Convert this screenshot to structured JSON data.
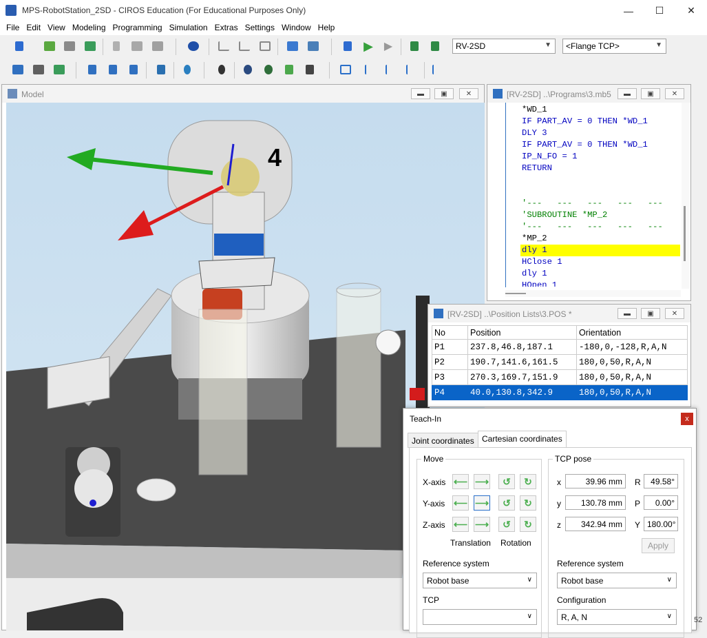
{
  "window": {
    "title": "MPS-RobotStation_2SD - CIROS Education (For Educational Purposes Only)",
    "minimize": "—",
    "maximize": "☐",
    "close": "✕"
  },
  "menu": [
    "File",
    "Edit",
    "View",
    "Modeling",
    "Programming",
    "Simulation",
    "Extras",
    "Settings",
    "Window",
    "Help"
  ],
  "toolbar": {
    "robot_select": "RV-2SD",
    "tcp_select": "<Flange TCP>"
  },
  "model_window": {
    "title": "Model",
    "axis_label": "4"
  },
  "program_window": {
    "title": "[RV-2SD] ..\\Programs\\3.mb5",
    "lines": [
      {
        "text": "*WD_1",
        "color": "#000000",
        "highlight": false
      },
      {
        "text": "IF PART_AV = 0 THEN *WD_1",
        "color": "#0000c0",
        "highlight": false
      },
      {
        "text": "DLY 3",
        "color": "#0000c0",
        "highlight": false
      },
      {
        "text": "IF PART_AV = 0 THEN *WD_1",
        "color": "#0000c0",
        "highlight": false
      },
      {
        "text": "IP_N_FO = 1",
        "color": "#0000c0",
        "highlight": false
      },
      {
        "text": "RETURN",
        "color": "#0000c0",
        "highlight": false
      },
      {
        "text": "",
        "color": "#000000",
        "highlight": false
      },
      {
        "text": "",
        "color": "#000000",
        "highlight": false
      },
      {
        "text": "'---   ---   ---   ---   ---",
        "color": "#008000",
        "highlight": false
      },
      {
        "text": "'SUBROUTINE *MP_2",
        "color": "#008000",
        "highlight": false
      },
      {
        "text": "'---   ---   ---   ---   ---",
        "color": "#008000",
        "highlight": false
      },
      {
        "text": "*MP_2",
        "color": "#000000",
        "highlight": false
      },
      {
        "text": "dly 1",
        "color": "#0000c0",
        "highlight": true
      },
      {
        "text": "HClose 1",
        "color": "#0000c0",
        "highlight": false
      },
      {
        "text": "dly 1",
        "color": "#0000c0",
        "highlight": false
      },
      {
        "text": "HOpen 1",
        "color": "#0000c0",
        "highlight": false
      }
    ]
  },
  "positions_window": {
    "title": "[RV-2SD] ..\\Position Lists\\3.POS *",
    "columns": [
      "No",
      "Position",
      "Orientation"
    ],
    "rows": [
      {
        "no": "P1",
        "position": "237.8,46.8,187.1",
        "orientation": "-180,0,-128,R,A,N",
        "selected": false
      },
      {
        "no": "P2",
        "position": "190.7,141.6,161.5",
        "orientation": "180,0,50,R,A,N",
        "selected": false
      },
      {
        "no": "P3",
        "position": "270.3,169.7,151.9",
        "orientation": "180,0,50,R,A,N",
        "selected": false
      },
      {
        "no": "P4",
        "position": "40.0,130.8,342.9",
        "orientation": "180,0,50,R,A,N",
        "selected": true
      }
    ]
  },
  "teach_in": {
    "title": "Teach-In",
    "close": "x",
    "tabs": [
      "Joint coordinates",
      "Cartesian coordinates"
    ],
    "move": {
      "label": "Move",
      "axes": [
        "X-axis",
        "Y-axis",
        "Z-axis"
      ],
      "translation": "Translation",
      "rotation": "Rotation",
      "reference_label": "Reference system",
      "reference_value": "Robot base",
      "tcp_label": "TCP",
      "tcp_value": ""
    },
    "tcp_pose": {
      "label": "TCP pose",
      "x_label": "x",
      "x": "39.96 mm",
      "y_label": "y",
      "y": "130.78 mm",
      "z_label": "z",
      "z": "342.94 mm",
      "r_label": "R",
      "r": "49.58°",
      "p_label": "P",
      "p": "0.00°",
      "yaw_label": "Y",
      "yaw": "180.00°",
      "apply": "Apply",
      "reference_label": "Reference system",
      "reference_value": "Robot base",
      "config_label": "Configuration",
      "config_value": "R, A, N"
    }
  },
  "status": {
    "corner_text": "52"
  }
}
